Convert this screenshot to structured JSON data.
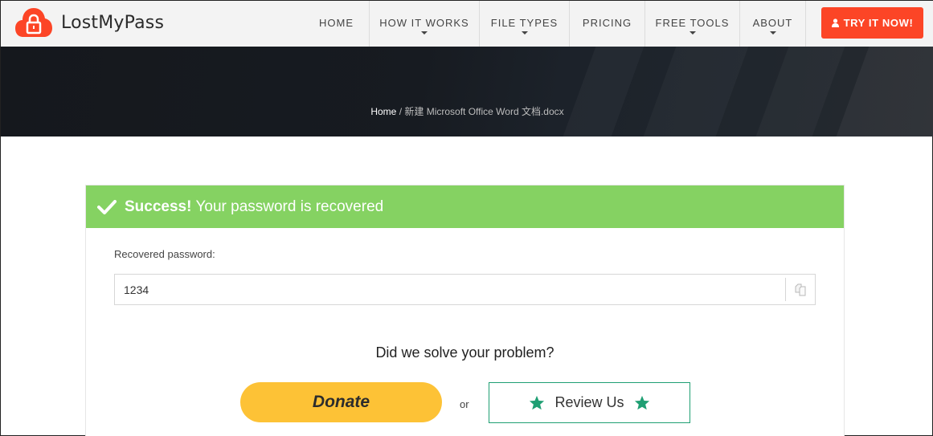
{
  "header": {
    "brand": "LostMyPass",
    "nav": [
      {
        "label": "HOME",
        "dropdown": false
      },
      {
        "label": "HOW IT WORKS",
        "dropdown": true
      },
      {
        "label": "FILE TYPES",
        "dropdown": true
      },
      {
        "label": "PRICING",
        "dropdown": false
      },
      {
        "label": "FREE TOOLS",
        "dropdown": true
      },
      {
        "label": "ABOUT",
        "dropdown": true
      }
    ],
    "cta_label": "TRY IT NOW!"
  },
  "breadcrumb": {
    "home": "Home",
    "separator": " / ",
    "current": "新建 Microsoft Office Word 文档.docx"
  },
  "result": {
    "success_strong": "Success!",
    "success_text": "Your password is recovered",
    "password_label": "Recovered password:",
    "password_value": "1234",
    "question": "Did we solve your problem?",
    "donate_label": "Donate",
    "or_label": "or",
    "review_label": "Review Us"
  },
  "colors": {
    "brand_red": "#fc4526",
    "success_green": "#85d262",
    "donate_yellow": "#fdc236",
    "review_green": "#1f9f73"
  }
}
